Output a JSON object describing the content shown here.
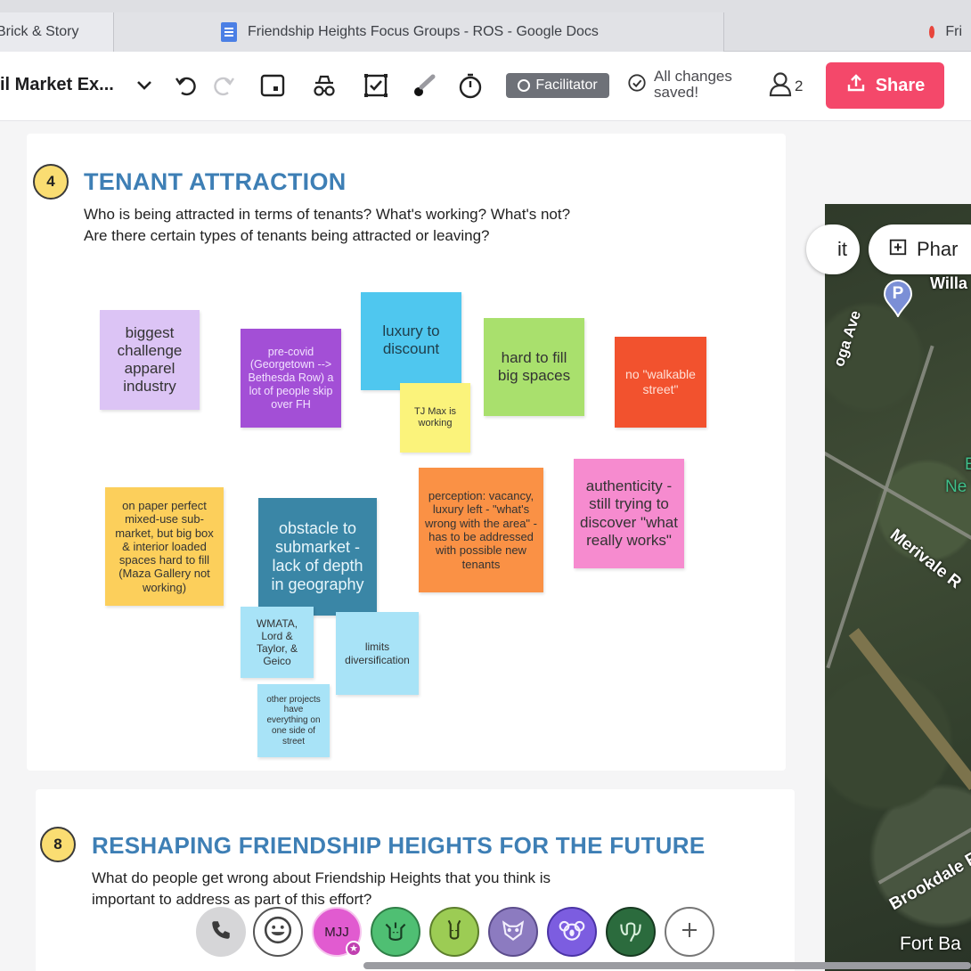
{
  "browser": {
    "tabs": [
      {
        "label": "Brick & Story"
      },
      {
        "label": "Friendship Heights Focus Groups - ROS - Google Docs"
      },
      {
        "label": "Fri"
      }
    ]
  },
  "toolbar": {
    "board_title": "il Market Ex...",
    "facilitator_label": "Facilitator",
    "saved_line1": "All changes",
    "saved_line2": "saved!",
    "user_count": "2",
    "share_label": "Share"
  },
  "sections": [
    {
      "number": "4",
      "title": "TENANT ATTRACTION",
      "question_line1": "Who is being attracted in terms of tenants?  What's working? What's not?",
      "question_line2": "Are there certain types of tenants being attracted or leaving?"
    },
    {
      "number": "8",
      "title": "RESHAPING FRIENDSHIP HEIGHTS FOR THE FUTURE",
      "question_line1": "What do people get wrong about Friendship Heights that you think is",
      "question_line2": "important to address as part of this effort?"
    }
  ],
  "stickies": [
    {
      "text": "biggest challenge apparel industry",
      "color": "#dcc4f5"
    },
    {
      "text": "pre-covid (Georgetown --> Bethesda Row) a lot of people skip over FH",
      "color": "#a34fd6"
    },
    {
      "text": "luxury to discount",
      "color": "#4fc7ef"
    },
    {
      "text": "TJ Max is working",
      "color": "#fbf37b"
    },
    {
      "text": "hard to fill big spaces",
      "color": "#a9e06d"
    },
    {
      "text": "no \"walkable street\"",
      "color": "#f2522e"
    },
    {
      "text": "on paper perfect mixed-use sub-market, but big box & interior loaded spaces hard to fill (Maza Gallery not working)",
      "color": "#fccf5b"
    },
    {
      "text": "obstacle to submarket - lack of depth in geography",
      "color": "#3a86a6"
    },
    {
      "text": "perception: vacancy, luxury left - \"what's wrong with the area\" - has to be addressed with possible new tenants",
      "color": "#fa9145"
    },
    {
      "text": "authenticity - still trying to discover \"what really works\"",
      "color": "#f68bcf"
    },
    {
      "text": "WMATA, Lord & Taylor, & Geico",
      "color": "#a8e3f7"
    },
    {
      "text": "limits diversification",
      "color": "#a8e3f7"
    },
    {
      "text": "other projects have everything on one side of street",
      "color": "#a8e3f7"
    }
  ],
  "map": {
    "chip_left": "it",
    "chip_right": "Phar",
    "pin_label": "P",
    "labels": [
      "Willa",
      "oga Ave",
      "E",
      "Ne",
      "Merivale R",
      "Brookdale R",
      "Fort Ba"
    ]
  },
  "participants": [
    {
      "kind": "phone-icon",
      "bg": "#d6d6d8"
    },
    {
      "kind": "emoji-icon",
      "bg": "#ffffff"
    },
    {
      "kind": "initials",
      "label": "MJJ",
      "bg": "#e15bd0"
    },
    {
      "kind": "rhino-icon",
      "bg": "#4fbf73"
    },
    {
      "kind": "horse-icon",
      "bg": "#9ccc54"
    },
    {
      "kind": "owl-icon",
      "bg": "#8c7bc0"
    },
    {
      "kind": "koala-icon",
      "bg": "#7c5de0"
    },
    {
      "kind": "elephant-icon",
      "bg": "#2b6b3d"
    },
    {
      "kind": "plus-icon",
      "bg": "#ffffff"
    }
  ]
}
